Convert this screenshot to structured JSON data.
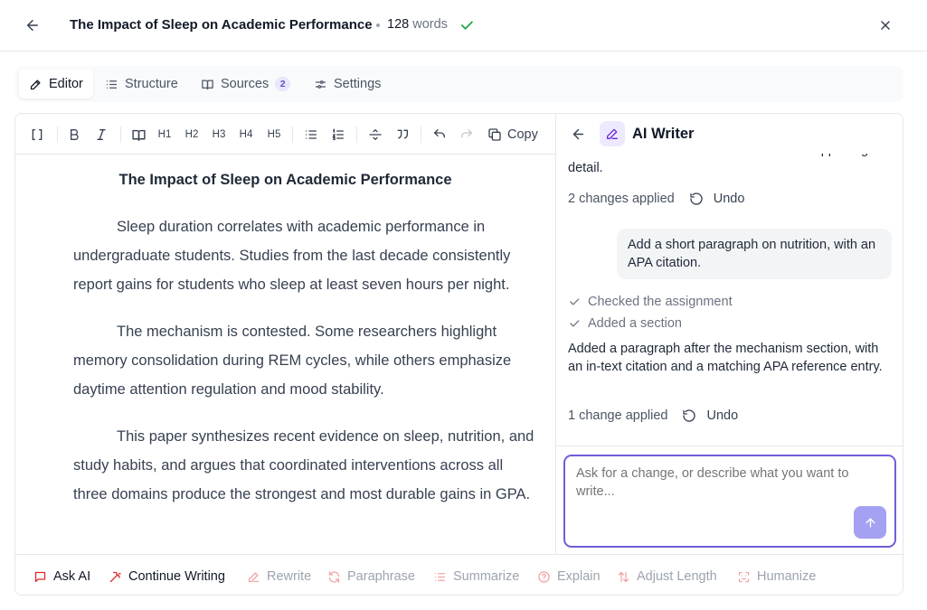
{
  "header": {
    "title": "The Impact of Sleep on Academic Performance",
    "word_count": "128",
    "word_unit": "words"
  },
  "tabs": [
    {
      "label": "Editor",
      "icon": "pencil-icon",
      "active": true
    },
    {
      "label": "Structure",
      "icon": "list-icon"
    },
    {
      "label": "Sources",
      "icon": "book-icon",
      "badge": "2"
    },
    {
      "label": "Settings",
      "icon": "sliders-icon"
    }
  ],
  "toolbar": {
    "headings": [
      "H1",
      "H2",
      "H3",
      "H4",
      "H5"
    ],
    "copy_label": "Copy"
  },
  "document": {
    "title": "The Impact of Sleep on Academic Performance",
    "paragraphs": [
      "Sleep duration correlates with academic performance in undergraduate students. Studies from the last decade consistently report gains for students who sleep at least seven hours per night.",
      "The mechanism is contested. Some researchers highlight memory consolidation during REM cycles, while others emphasize daytime attention regulation and mood stability.",
      "This paper synthesizes recent evidence on sleep, nutrition, and study habits, and argues that coordinated interventions across all three domains produce the strongest and most durable gains in GPA."
    ]
  },
  "ai_writer": {
    "title": "AI Writer",
    "prev_text": "names the three interventions before the supporting detail.",
    "prev_applied": "2 changes applied",
    "undo_label": "Undo",
    "user_message": "Add a short paragraph on nutrition, with an APA citation.",
    "steps": [
      "Checked the assignment",
      "Added a section"
    ],
    "response": "Added a paragraph after the mechanism section, with an in-text citation and a matching APA reference entry.",
    "applied": "1 change applied",
    "input_placeholder": "Ask for a change, or describe what you want to write..."
  },
  "actions": [
    {
      "label": "Ask AI",
      "icon": "chat-icon",
      "enabled": true
    },
    {
      "label": "Continue Writing",
      "icon": "wand-icon",
      "enabled": true
    },
    {
      "label": "Rewrite",
      "icon": "pen-icon",
      "enabled": false
    },
    {
      "label": "Paraphrase",
      "icon": "refresh-icon",
      "enabled": false
    },
    {
      "label": "Summarize",
      "icon": "list-icon",
      "enabled": false
    },
    {
      "label": "Explain",
      "icon": "help-circle-icon",
      "enabled": false
    },
    {
      "label": "Adjust Length",
      "icon": "arrows-vertical-icon",
      "enabled": false
    },
    {
      "label": "Humanize",
      "icon": "scan-face-icon",
      "enabled": false
    }
  ],
  "colors": {
    "accent": "#6d5fd8",
    "accent_light": "#ede9fe",
    "action_icon": "#dc2626",
    "action_icon_muted": "#f0a3a3",
    "success": "#16a34a"
  }
}
